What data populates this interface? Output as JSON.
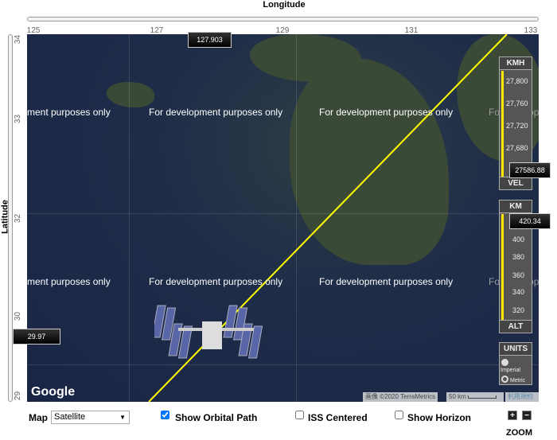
{
  "axes": {
    "longitude_title": "Longitude",
    "latitude_title": "Latitude",
    "longitude_ticks": [
      "125",
      "127",
      "129",
      "131",
      "133"
    ],
    "latitude_ticks": [
      "34",
      "33",
      "32",
      "30",
      "29"
    ],
    "longitude_value": "127.903",
    "latitude_value": "29.97"
  },
  "map": {
    "watermark": "For development purposes only",
    "watermark_partial": "ment purposes only",
    "watermark_right": "For develop",
    "logo": "Google",
    "attribution": "画像 ©2020 TerraMetrics",
    "scale": "50 km",
    "terms": "利用規約",
    "orbit_color": "#ffff00"
  },
  "velocity": {
    "unit": "KMH",
    "label": "VEL",
    "ticks": [
      "27,800",
      "27,760",
      "27,720",
      "27,680"
    ],
    "value": "27586.88"
  },
  "altitude": {
    "unit": "KM",
    "label": "ALT",
    "ticks": [
      "400",
      "380",
      "360",
      "340",
      "320"
    ],
    "value": "420.34"
  },
  "units": {
    "title": "UNITS",
    "options": [
      "Imperial",
      "Metric"
    ],
    "selected": "Metric"
  },
  "controls": {
    "map_label": "Map",
    "map_type": "Satellite",
    "show_orbital_path": "Show Orbital Path",
    "orbital_checked": true,
    "iss_centered": "ISS Centered",
    "show_horizon": "Show Horizon",
    "zoom_label": "ZOOM",
    "zoom_in": "+",
    "zoom_out": "−"
  }
}
